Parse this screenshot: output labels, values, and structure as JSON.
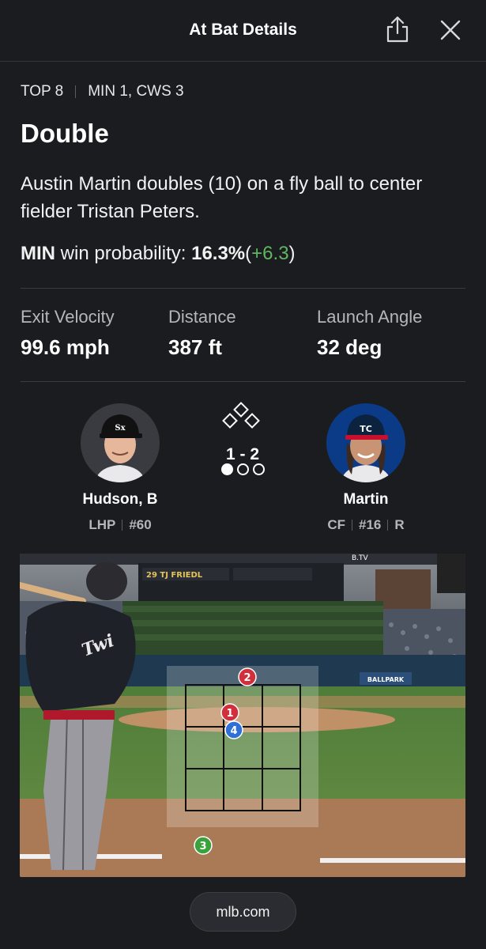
{
  "header": {
    "title": "At Bat Details",
    "share_icon": "share-icon",
    "close_icon": "close-icon"
  },
  "game": {
    "inning": "TOP 8",
    "score": "MIN 1, CWS 3"
  },
  "play": {
    "result": "Double",
    "description": "Austin Martin doubles (10) on a fly ball to center fielder Tristan Peters."
  },
  "win_probability": {
    "team": "MIN",
    "label": "win probability:",
    "value": "16.3%",
    "open": "(",
    "delta": "+6.3",
    "close": ")",
    "delta_color": "#5fb85f"
  },
  "stats": [
    {
      "label": "Exit Velocity",
      "value": "99.6 mph"
    },
    {
      "label": "Distance",
      "value": "387 ft"
    },
    {
      "label": "Launch Angle",
      "value": "32 deg"
    }
  ],
  "pitcher": {
    "name": "Hudson, B",
    "hand": "LHP",
    "number": "#60",
    "avatar_bg": "#3a3b40"
  },
  "batter": {
    "name": "Martin",
    "position": "CF",
    "number": "#16",
    "bats": "R",
    "avatar_bg": "#0b3b86"
  },
  "count": {
    "text": "1 - 2",
    "outs_filled": 1,
    "outs_total": 3
  },
  "scoreboard": {
    "batter_label": "29 TJ FRIEDL",
    "sign_label": "B.TV",
    "sponsor": "BALLPARK"
  },
  "pitches": [
    {
      "number": "1",
      "color": "#d22f3c"
    },
    {
      "number": "2",
      "color": "#d22f3c"
    },
    {
      "number": "3",
      "color": "#3aa23a"
    },
    {
      "number": "4",
      "color": "#2f6fd6"
    }
  ],
  "source": {
    "label": "mlb.com"
  }
}
